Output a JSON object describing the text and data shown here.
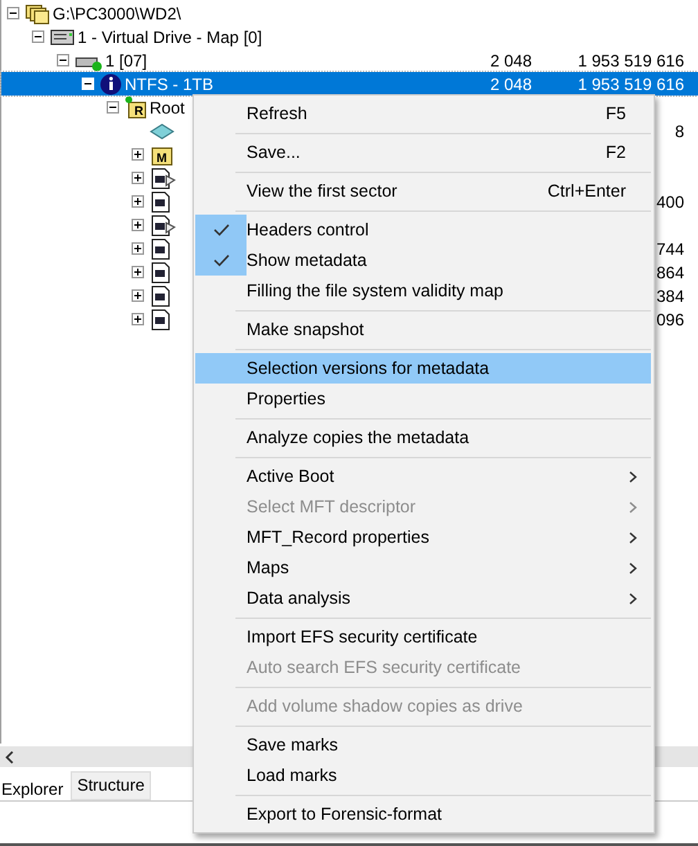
{
  "tree": [
    {
      "label": "G:\\PC3000\\WD2\\",
      "kind": "folders",
      "expanded": true,
      "selected": false,
      "children": [
        {
          "label": "1 - Virtual Drive - Map [0]",
          "kind": "drive",
          "expanded": true,
          "selected": false,
          "children": [
            {
              "label": "1 [07]",
              "kind": "disk",
              "expanded": true,
              "selected": false,
              "column_2": "2 048",
              "column_3": "1 953 519 616",
              "children": [
                {
                  "label": "NTFS - 1TB",
                  "kind": "info",
                  "expanded": true,
                  "selected": true,
                  "column_2": "2 048",
                  "column_3": "1 953 519 616",
                  "children": [
                    {
                      "label": "Root",
                      "kind": "root",
                      "icon_letter": "R",
                      "expanded": true,
                      "selected": false,
                      "children": [
                        {
                          "kind": "diamond",
                          "selected": false,
                          "column_3": "8"
                        },
                        {
                          "kind": "mfolder",
                          "icon_letter": "M",
                          "expanded": false,
                          "selected": false
                        },
                        {
                          "kind": "linkfile",
                          "expanded": false,
                          "selected": false
                        },
                        {
                          "kind": "file",
                          "expanded": false,
                          "selected": false,
                          "column_3": "400"
                        },
                        {
                          "kind": "linkfile",
                          "expanded": false,
                          "selected": false
                        },
                        {
                          "kind": "file",
                          "expanded": false,
                          "selected": false,
                          "column_3": "744"
                        },
                        {
                          "kind": "file",
                          "expanded": false,
                          "selected": false,
                          "column_3": "864"
                        },
                        {
                          "kind": "file",
                          "expanded": false,
                          "selected": false,
                          "column_3": "384"
                        },
                        {
                          "kind": "file",
                          "expanded": false,
                          "selected": false,
                          "column_3": "096"
                        }
                      ]
                    }
                  ]
                }
              ]
            }
          ]
        }
      ]
    }
  ],
  "tabs": [
    {
      "label": "Explorer",
      "selected": true
    },
    {
      "label": "Structure",
      "selected": false
    }
  ],
  "context_menu": [
    {
      "kind": "item",
      "label": "Refresh",
      "shortcut": "F5",
      "checked": false,
      "disabled": false,
      "selected": false,
      "submenu": false
    },
    {
      "kind": "separator"
    },
    {
      "kind": "item",
      "label": "Save...",
      "shortcut": "F2",
      "checked": false,
      "disabled": false,
      "selected": false,
      "submenu": false
    },
    {
      "kind": "separator"
    },
    {
      "kind": "item",
      "label": "View the first sector",
      "shortcut": "Ctrl+Enter",
      "checked": false,
      "disabled": false,
      "selected": false,
      "submenu": false
    },
    {
      "kind": "separator"
    },
    {
      "kind": "item",
      "label": "Headers control",
      "checked": true,
      "disabled": false,
      "selected": false,
      "submenu": false
    },
    {
      "kind": "item",
      "label": "Show metadata",
      "checked": true,
      "disabled": false,
      "selected": false,
      "submenu": false
    },
    {
      "kind": "item",
      "label": "Filling the file system validity map",
      "checked": false,
      "disabled": false,
      "selected": false,
      "submenu": false
    },
    {
      "kind": "separator"
    },
    {
      "kind": "item",
      "label": "Make snapshot",
      "checked": false,
      "disabled": false,
      "selected": false,
      "submenu": false
    },
    {
      "kind": "separator"
    },
    {
      "kind": "item",
      "label": "Selection versions for metadata",
      "checked": false,
      "disabled": false,
      "selected": true,
      "submenu": false
    },
    {
      "kind": "item",
      "label": "Properties",
      "checked": false,
      "disabled": false,
      "selected": false,
      "submenu": false
    },
    {
      "kind": "separator"
    },
    {
      "kind": "item",
      "label": "Analyze copies the metadata",
      "checked": false,
      "disabled": false,
      "selected": false,
      "submenu": false
    },
    {
      "kind": "separator"
    },
    {
      "kind": "item",
      "label": "Active Boot",
      "checked": false,
      "disabled": false,
      "selected": false,
      "submenu": true
    },
    {
      "kind": "item",
      "label": "Select MFT descriptor",
      "checked": false,
      "disabled": true,
      "selected": false,
      "submenu": true
    },
    {
      "kind": "item",
      "label": "MFT_Record properties",
      "checked": false,
      "disabled": false,
      "selected": false,
      "submenu": true
    },
    {
      "kind": "item",
      "label": "Maps",
      "checked": false,
      "disabled": false,
      "selected": false,
      "submenu": true
    },
    {
      "kind": "item",
      "label": "Data analysis",
      "checked": false,
      "disabled": false,
      "selected": false,
      "submenu": true
    },
    {
      "kind": "separator"
    },
    {
      "kind": "item",
      "label": "Import EFS security certificate",
      "checked": false,
      "disabled": false,
      "selected": false,
      "submenu": false
    },
    {
      "kind": "item",
      "label": "Auto search EFS security certificate",
      "checked": false,
      "disabled": true,
      "selected": false,
      "submenu": false
    },
    {
      "kind": "separator"
    },
    {
      "kind": "item",
      "label": "Add volume shadow copies as drive",
      "checked": false,
      "disabled": true,
      "selected": false,
      "submenu": false
    },
    {
      "kind": "separator"
    },
    {
      "kind": "item",
      "label": "Save marks",
      "checked": false,
      "disabled": false,
      "selected": false,
      "submenu": false
    },
    {
      "kind": "item",
      "label": "Load marks",
      "checked": false,
      "disabled": false,
      "selected": false,
      "submenu": false
    },
    {
      "kind": "separator"
    },
    {
      "kind": "item",
      "label": "Export to Forensic-format",
      "checked": false,
      "disabled": false,
      "selected": false,
      "submenu": false
    }
  ]
}
